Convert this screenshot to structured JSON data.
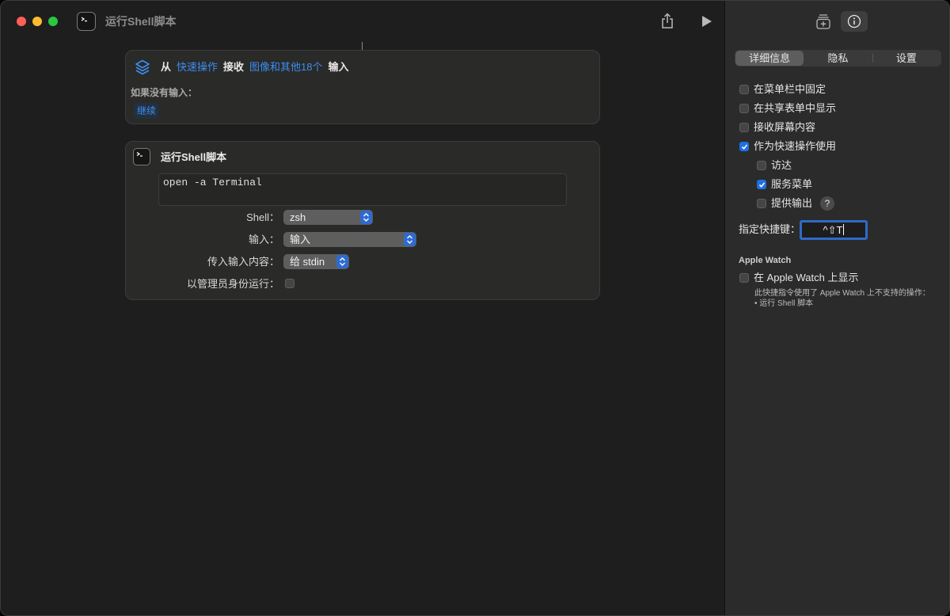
{
  "window": {
    "title": "运行Shell脚本"
  },
  "icons": {
    "app": "terminal-icon",
    "share": "share-icon",
    "run": "play-icon",
    "library": "add-to-library-icon",
    "info": "info-icon",
    "receive_action": "quick-action-icon",
    "shell_action": "terminal-icon"
  },
  "colors": {
    "accent": "#3b8ef3",
    "checkbox_on": "#1f6fe5",
    "window_bg": "#1e1e1e",
    "sidebar_bg": "#2b2b2b",
    "card_bg": "#2a2a28"
  },
  "workflow": {
    "receive": {
      "from": "从",
      "source": "快速操作",
      "receive": "接收",
      "types": "图像和其他18个",
      "input": "输入",
      "no_input_label": "如果没有输入：",
      "no_input_action": "继续"
    },
    "shell_action": {
      "title": "运行Shell脚本",
      "script": "open -a Terminal",
      "shell": {
        "label": "Shell：",
        "value": "zsh"
      },
      "input": {
        "label": "输入：",
        "value": "输入"
      },
      "pass_input": {
        "label": "传入输入内容：",
        "value": "给 stdin"
      },
      "run_as_admin": {
        "label": "以管理员身份运行：",
        "checked": false
      }
    }
  },
  "inspector": {
    "tabs": [
      {
        "label": "详细信息",
        "selected": true
      },
      {
        "label": "隐私",
        "selected": false
      },
      {
        "label": "设置",
        "selected": false
      }
    ],
    "options": {
      "pin_menu_bar": {
        "label": "在菜单栏中固定",
        "checked": false
      },
      "share_sheet": {
        "label": "在共享表单中显示",
        "checked": false
      },
      "receive_screen": {
        "label": "接收屏幕内容",
        "checked": false
      },
      "quick_action": {
        "label": "作为快速操作使用",
        "checked": true
      },
      "finder": {
        "label": "访达",
        "checked": false
      },
      "services_menu": {
        "label": "服务菜单",
        "checked": true
      },
      "provide_output": {
        "label": "提供输出",
        "checked": false,
        "help": "?"
      }
    },
    "shortcut": {
      "label": "指定快捷键：",
      "value": "^⇧T"
    },
    "apple_watch": {
      "heading": "Apple Watch",
      "show_label": "在 Apple Watch 上显示",
      "checked": false,
      "note": "此快捷指令使用了 Apple Watch 上不支持的操作：",
      "unsupported_item": "• 运行 Shell 脚本"
    }
  }
}
